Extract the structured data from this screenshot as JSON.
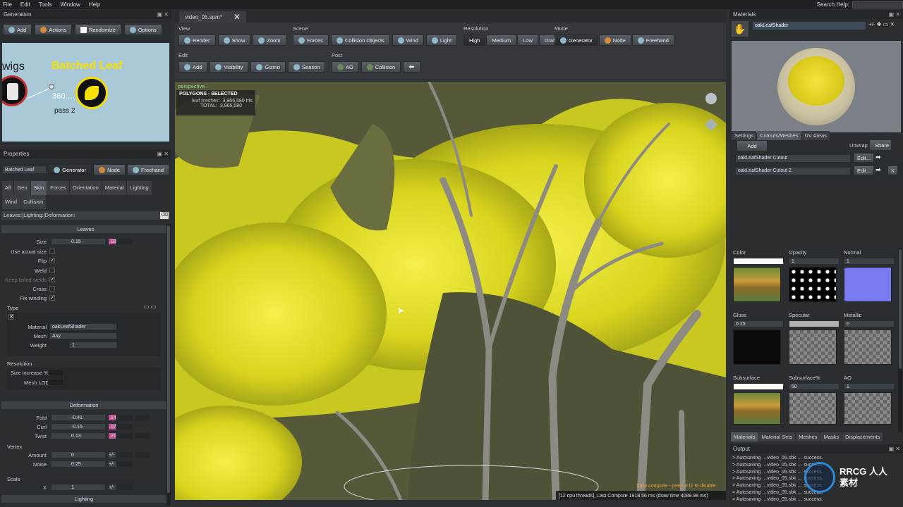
{
  "menu": [
    "File",
    "Edit",
    "Tools",
    "Window",
    "Help"
  ],
  "search_help_label": "Search Help:",
  "generation": {
    "title": "Generation",
    "buttons": [
      "Add",
      "Actions",
      "Randomize",
      "Options"
    ],
    "node_left_label": "wigs",
    "node_title": "Batched Leaf",
    "node_value": "360,…",
    "node_pass": "pass 2"
  },
  "properties": {
    "title": "Properties",
    "selected_name": "Batched Leaf",
    "modes": [
      "Generator",
      "Node",
      "Freehand"
    ],
    "tabs": [
      "All",
      "Gen",
      "Skin",
      "Forces",
      "Orientation",
      "Material",
      "Lighting",
      "Wind",
      "Collision"
    ],
    "filter": "Leaves:|Lighting:|Deformation:",
    "leaves_header": "Leaves",
    "size_label": "Size",
    "size_value": "0.15",
    "size_rand": ".03",
    "checks": [
      {
        "label": "Use actual size",
        "checked": false
      },
      {
        "label": "Flip",
        "checked": true
      },
      {
        "label": "Weld",
        "checked": false
      },
      {
        "label": "Keep failed welds",
        "checked": true
      },
      {
        "label": "Cross",
        "checked": false
      },
      {
        "label": "Fix winding",
        "checked": true
      }
    ],
    "type_label": "Type",
    "material_label": "Material",
    "material_value": "oakLeafShader",
    "mesh_label": "Mesh",
    "mesh_value": "Any",
    "weight_label": "Weight",
    "weight_value": "1",
    "resolution_label": "Resolution",
    "size_increase_label": "Size increase %",
    "mesh_lod_label": "Mesh LOD",
    "deformation_header": "Deformation",
    "fold_label": "Fold",
    "fold_value": "-0.41",
    "fold_rand": ".14",
    "curl_label": "Curl",
    "curl_value": "-0.15",
    "curl_rand": ".07",
    "twist_label": "Twist",
    "twist_value": "0.13",
    "twist_rand": ".21",
    "vertex_label": "Vertex",
    "amount_label": "Amount",
    "amount_value": "0",
    "amount_rand": "+/-",
    "noise_label": "Noise",
    "noise_value": "0.25",
    "noise_rand": "+/-",
    "scale_label": "Scale",
    "x_label": "X",
    "x_value": "1",
    "x_rand": "+/-",
    "lighting_header": "Lighting"
  },
  "document_tab": "video_05.spm*",
  "toolbar": {
    "view_label": "View",
    "view": [
      "Render",
      "Show",
      "Zoom"
    ],
    "scene_label": "Scene",
    "scene": [
      "Forces",
      "Collision Objects",
      "Wind",
      "Light"
    ],
    "resolution_label": "Resolution",
    "resolution": [
      "High",
      "Medium",
      "Low",
      "Draft"
    ],
    "mode_label": "Mode",
    "mode": [
      "Generator",
      "Node",
      "Freehand"
    ],
    "edit_label": "Edit",
    "edit": [
      "Add",
      "Visibility",
      "Gizmo",
      "Season"
    ],
    "post_label": "Post",
    "post": [
      "AO",
      "Collision"
    ]
  },
  "viewport": {
    "label": "perspective",
    "stats_title": "POLYGONS - SELECTED",
    "leaf_meshes_label": "leaf meshes:",
    "leaf_meshes_value": "3,965,580 tris",
    "total_label": "TOTAL:",
    "total_value": "3,965,580",
    "slow_compute": "Slow compute - press F11 to disable",
    "compute_info": "[12 cpu threads], Last Compute 1918.56 ms (draw time 4089.98 ms)"
  },
  "materials": {
    "title": "Materials",
    "selected": "oakLeafShader",
    "tabs": [
      "Settings",
      "Cutouts/Meshes",
      "UV Areas"
    ],
    "add_label": "Add",
    "unwrap_label": "Unwrap",
    "share_label": "Share",
    "cutouts": [
      "oakLeafShader Cutout",
      "oakLeafShader Cutout 2"
    ],
    "edit_label": "Edit...",
    "x_label": "X",
    "maps": [
      {
        "name": "Color",
        "value": ""
      },
      {
        "name": "Opacity",
        "value": "1"
      },
      {
        "name": "Normal",
        "value": "1"
      },
      {
        "name": "Gloss",
        "value": "0.25"
      },
      {
        "name": "Specular",
        "value": ""
      },
      {
        "name": "Metallic",
        "value": "0"
      },
      {
        "name": "Subsurface",
        "value": ""
      },
      {
        "name": "Subsurface%",
        "value": "50"
      },
      {
        "name": "AO",
        "value": "1"
      }
    ],
    "bottom_tabs": [
      "Materials",
      "Material Sets",
      "Meshes",
      "Masks",
      "Displacements"
    ]
  },
  "output": {
    "title": "Output",
    "lines": [
      "> Autosaving …video_05.sbk … success.",
      "> Autosaving …video_05.sbk … success.",
      "> Autosaving …video_05.sbk … success.",
      "> Autosaving …video_05.sbk … success.",
      "> Autosaving …video_05.sbk … success.",
      "> Autosaving …video_05.sbk … success.",
      "> Autosaving …video_05.sbk … success."
    ]
  },
  "watermark": "RRCG 人人素材"
}
